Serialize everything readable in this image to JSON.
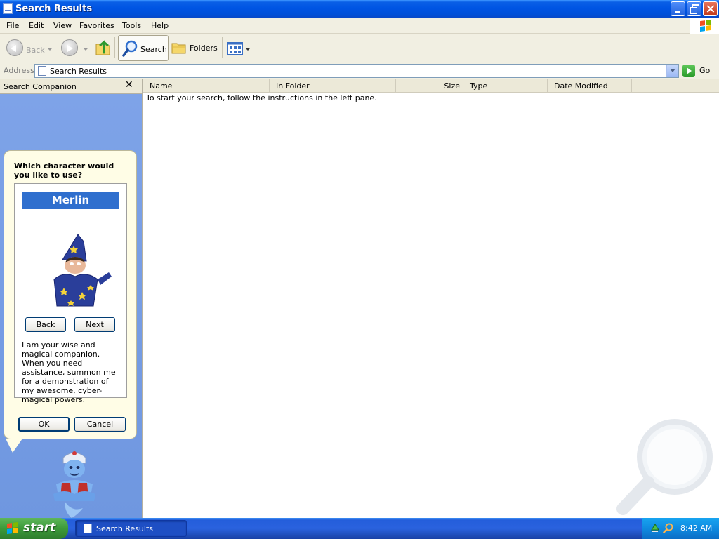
{
  "window": {
    "title": "Search Results"
  },
  "menubar": {
    "items": [
      "File",
      "Edit",
      "View",
      "Favorites",
      "Tools",
      "Help"
    ]
  },
  "toolbar": {
    "back_label": "Back",
    "search_label": "Search",
    "folders_label": "Folders"
  },
  "address": {
    "label": "Address",
    "value": "Search Results",
    "go_label": "Go"
  },
  "companion": {
    "header": "Search Companion",
    "question": "Which character would you like to use?",
    "character_name": "Merlin",
    "back_label": "Back",
    "next_label": "Next",
    "description": "I am your wise and magical companion. When you need assistance, summon me for a demonstration of my awesome, cyber-magical powers.",
    "ok_label": "OK",
    "cancel_label": "Cancel"
  },
  "results": {
    "columns": [
      "Name",
      "In Folder",
      "Size",
      "Type",
      "Date Modified"
    ],
    "empty_message": "To start your search, follow the instructions in the left pane."
  },
  "taskbar": {
    "start_label": "start",
    "task_label": "Search Results",
    "clock": "8:42 AM"
  },
  "colors": {
    "titlebar": "#0054e3",
    "pane_blue": "#7aa1e6",
    "start_green": "#3c9a3a",
    "accent": "#2f6fce"
  }
}
